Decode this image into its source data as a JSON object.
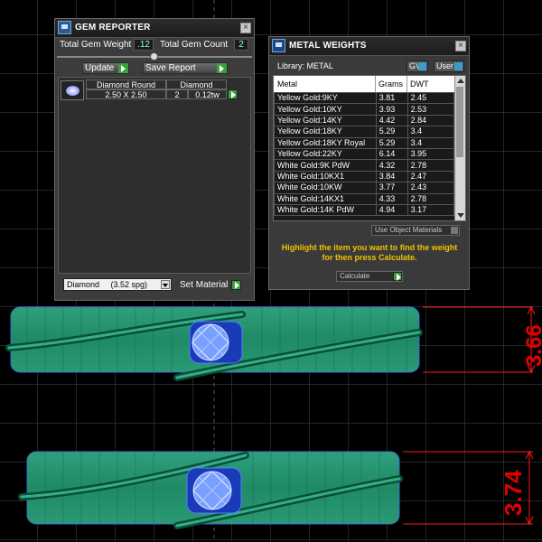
{
  "gem_reporter": {
    "title": "GEM REPORTER",
    "total_weight_label": "Total Gem Weight",
    "total_weight_value": ".12",
    "total_count_label": "Total Gem Count",
    "total_count_value": "2",
    "update_label": "Update",
    "save_report_label": "Save Report",
    "row": {
      "name": "Diamond Round",
      "size": "2.50 X 2.50",
      "material": "Diamond",
      "count": "2",
      "weight": "0.12tw"
    },
    "material_select": "Diamond     (3.52 spg)",
    "set_material_label": "Set Material"
  },
  "metal_weights": {
    "title": "METAL WEIGHTS",
    "library_label": "Library: METAL",
    "gv_label": "GV",
    "user_label": "User",
    "columns": [
      "Metal",
      "Grams",
      "DWT"
    ],
    "rows": [
      [
        "Yellow Gold:9KY",
        "3.81",
        "2.45"
      ],
      [
        "Yellow Gold:10KY",
        "3.93",
        "2.53"
      ],
      [
        "Yellow Gold:14KY",
        "4.42",
        "2.84"
      ],
      [
        "Yellow Gold:18KY",
        "5.29",
        "3.4"
      ],
      [
        "Yellow Gold:18KY Royal",
        "5.29",
        "3.4"
      ],
      [
        "Yellow Gold:22KY",
        "6.14",
        "3.95"
      ],
      [
        "White Gold:9K PdW",
        "4.32",
        "2.78"
      ],
      [
        "White Gold:10KX1",
        "3.84",
        "2.47"
      ],
      [
        "White Gold:10KW",
        "3.77",
        "2.43"
      ],
      [
        "White Gold:14KX1",
        "4.33",
        "2.78"
      ],
      [
        "White Gold:14K PdW",
        "4.94",
        "3.17"
      ]
    ],
    "use_object_materials_label": "Use Object Materials",
    "hint": "Highlight the item you want to find the weight for then press Calculate.",
    "calculate_label": "Calculate"
  },
  "dimensions": {
    "top_value": "3.66",
    "bottom_value": "3.74"
  },
  "colors": {
    "grid": "#3a3a3a",
    "ring": "#1f9a6e",
    "dimension": "#e00000",
    "hint": "#f2c200"
  }
}
